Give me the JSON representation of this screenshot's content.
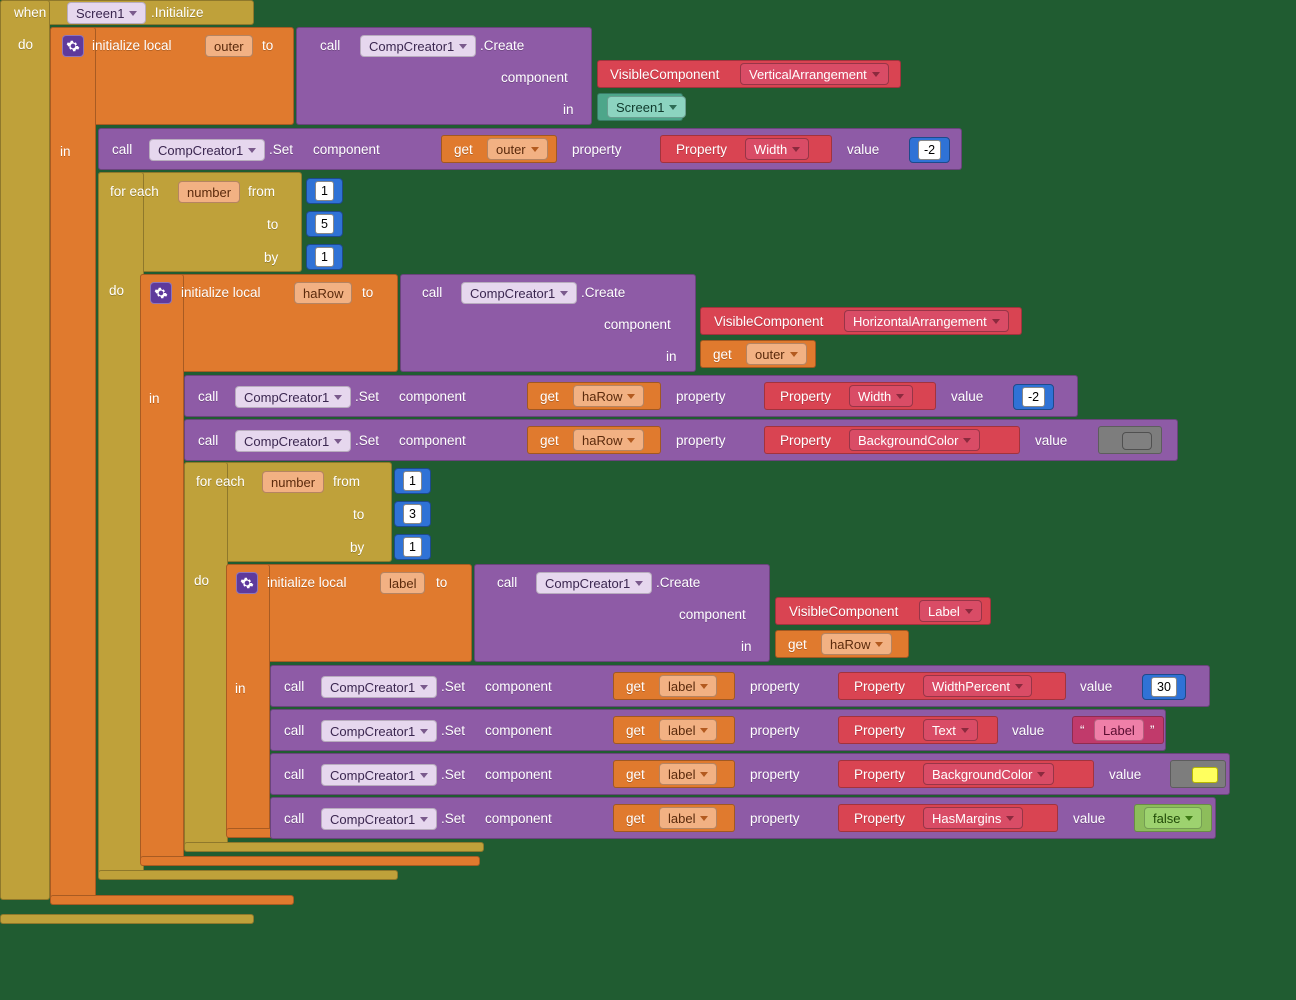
{
  "when": "when",
  "screen1": "Screen1",
  "init": ".Initialize",
  "do": "do",
  "in": "in",
  "to": "to",
  "by": "by",
  "from": "from",
  "forEach": "for each",
  "number": "number",
  "initLocal": "initialize local",
  "outer": "outer",
  "haRow": "haRow",
  "labelVar": "label",
  "call": "call",
  "comp": "CompCreator1",
  "create": ".Create",
  "set": ".Set",
  "component": "component",
  "property": "property",
  "value": "value",
  "visComp": "VisibleComponent",
  "vert": "VerticalArrangement",
  "horiz": "HorizontalArrangement",
  "labelComp": "Label",
  "propLbl": "Property",
  "width": "Width",
  "widthPct": "WidthPercent",
  "text": "Text",
  "bg": "BackgroundColor",
  "margins": "HasMargins",
  "get": "get",
  "false": "false",
  "n1": "1",
  "n3": "3",
  "n5": "5",
  "n30": "30",
  "nm2": "-2",
  "labelStr": "Label",
  "q1": "“",
  "q2": "”"
}
